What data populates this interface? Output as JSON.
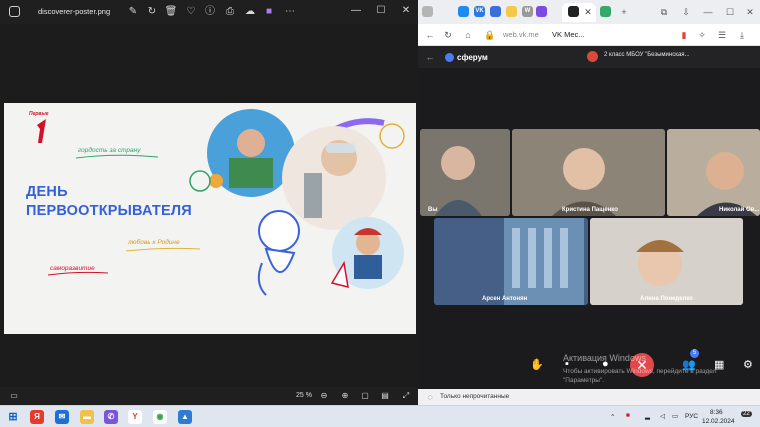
{
  "viewer": {
    "file_name": "discoverer-poster.png",
    "zoom": "25 %",
    "toolbar_icons": [
      "edit-icon",
      "rotate-icon",
      "delete-icon",
      "favorite-icon",
      "info-icon",
      "print-icon",
      "onedrive-icon",
      "clipchamp-icon",
      "more-icon"
    ]
  },
  "poster": {
    "logo_word": "Первые",
    "heading_line1": "ДЕНЬ",
    "heading_line2": "ПЕРВООТКРЫВАТЕЛЯ",
    "tag_pride": "гордость за страну",
    "tag_love": "любовь к Родине",
    "tag_growth": "саморазвитие"
  },
  "browser": {
    "url_domain": "web.vk.me",
    "page_title": "VK Мес...",
    "tab_labels": [
      "VK",
      "W",
      "Я"
    ]
  },
  "call": {
    "service_name": "сферум",
    "chat_title": "2 класс МБОУ \"Безыминская...",
    "participants": [
      {
        "name": "Вы"
      },
      {
        "name": "Кристина Пащенко"
      },
      {
        "name": "Николай Ов..."
      },
      {
        "name": "Арсен Антонян"
      },
      {
        "name": "Алина Понеделко"
      }
    ],
    "participants_count": "5",
    "activation_line1": "Активация Windows",
    "activation_line2": "Чтобы активировать Windows, перейдите в раздел",
    "activation_line3": "\"Параметры\".",
    "unread_filter": "Только непрочитанные"
  },
  "taskbar": {
    "lang": "РУС",
    "time": "8:36",
    "date": "12.02.2024",
    "notifications": "22"
  },
  "colors": {
    "accent_blue": "#3560d8",
    "end_call_red": "#e3474b",
    "brand_red": "#d3102a"
  }
}
